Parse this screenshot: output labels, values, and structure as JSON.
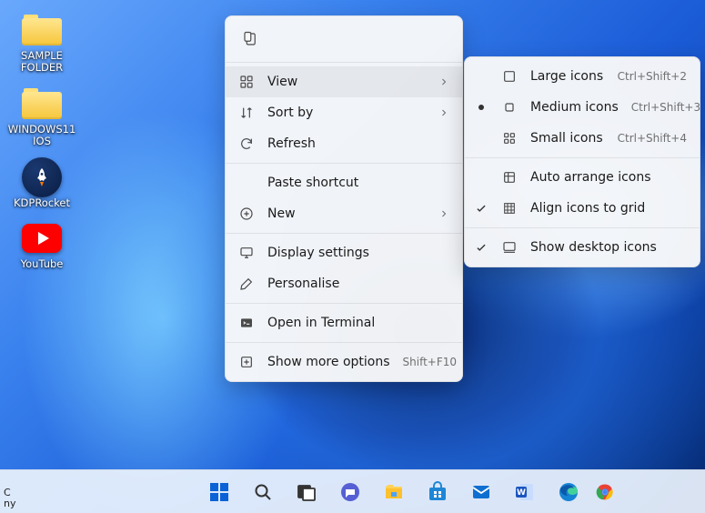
{
  "desktop_icons": [
    {
      "name": "sample-folder",
      "label": "SAMPLE FOLDER",
      "kind": "folder"
    },
    {
      "name": "windows11-ios",
      "label": "WINDOWS11 IOS",
      "kind": "folder"
    },
    {
      "name": "kdprocket",
      "label": "KDPRocket",
      "kind": "rocket"
    },
    {
      "name": "youtube",
      "label": "YouTube",
      "kind": "youtube"
    }
  ],
  "context_menu": {
    "view": {
      "label": "View",
      "has_submenu": true,
      "hovered": true
    },
    "sort": {
      "label": "Sort by",
      "has_submenu": true
    },
    "refresh": {
      "label": "Refresh"
    },
    "paste_shortcut": {
      "label": "Paste shortcut"
    },
    "new": {
      "label": "New",
      "has_submenu": true
    },
    "display": {
      "label": "Display settings"
    },
    "personalise": {
      "label": "Personalise"
    },
    "terminal": {
      "label": "Open in Terminal"
    },
    "more": {
      "label": "Show more options",
      "shortcut": "Shift+F10"
    }
  },
  "view_submenu": {
    "large": {
      "label": "Large icons",
      "shortcut": "Ctrl+Shift+2"
    },
    "medium": {
      "label": "Medium icons",
      "shortcut": "Ctrl+Shift+3",
      "selected": true
    },
    "small": {
      "label": "Small icons",
      "shortcut": "Ctrl+Shift+4"
    },
    "auto": {
      "label": "Auto arrange icons"
    },
    "align": {
      "label": "Align icons to grid",
      "checked": true
    },
    "show": {
      "label": "Show desktop icons",
      "checked": true
    }
  },
  "taskbar_items": [
    {
      "name": "start"
    },
    {
      "name": "search"
    },
    {
      "name": "taskview"
    },
    {
      "name": "chat"
    },
    {
      "name": "explorer"
    },
    {
      "name": "store"
    },
    {
      "name": "mail"
    },
    {
      "name": "word"
    },
    {
      "name": "edge"
    },
    {
      "name": "chrome"
    }
  ],
  "sys_left": {
    "line1": "C",
    "line2": "ny"
  }
}
